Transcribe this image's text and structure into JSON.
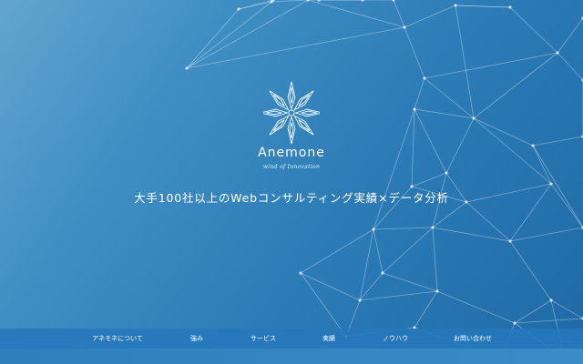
{
  "brand": {
    "logo_text": "Anemone",
    "tagline": "wind of Innovation"
  },
  "hero": {
    "headline": "大手100社以上のWebコンサルティング実績×データ分析"
  },
  "nav": {
    "items": [
      {
        "label": "アネモネについて"
      },
      {
        "label": "強み"
      },
      {
        "label": "サービス"
      },
      {
        "label": "実績"
      },
      {
        "label": "ノウハウ"
      },
      {
        "label": "お問い合わせ"
      }
    ]
  },
  "colors": {
    "background_start": "#62a5d0",
    "background_end": "#1f6aa6",
    "navbar": "#2678bc",
    "text": "#ffffff"
  },
  "icons": [
    "snowflake-logo-icon"
  ]
}
